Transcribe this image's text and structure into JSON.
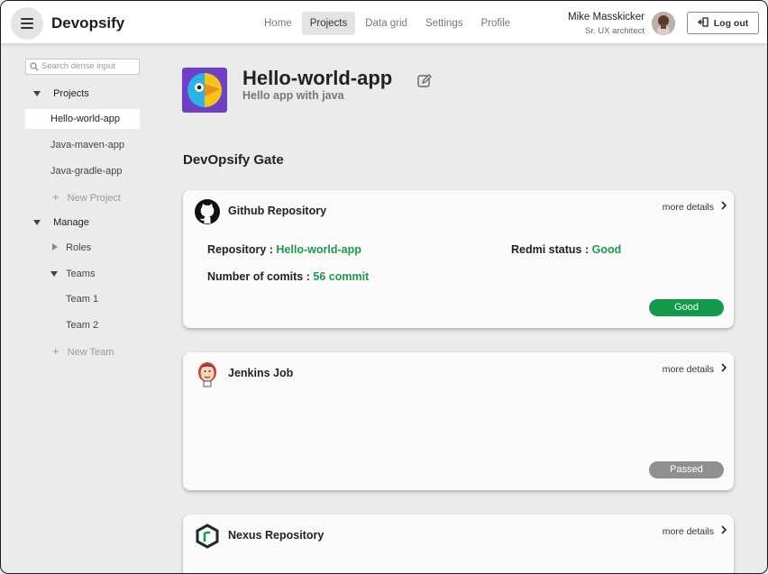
{
  "header": {
    "brand": "Devopsify",
    "nav": [
      {
        "label": "Home",
        "active": false
      },
      {
        "label": "Projects",
        "active": true
      },
      {
        "label": "Data grid",
        "active": false
      },
      {
        "label": "Settings",
        "active": false
      },
      {
        "label": "Profile",
        "active": false
      }
    ],
    "user": {
      "name": "Mike Masskicker",
      "role": "Sr. UX architect"
    },
    "logout_label": "Log out"
  },
  "sidebar": {
    "search_placeholder": "Search dense input",
    "projects_label": "Projects",
    "projects": [
      "Hello-world-app",
      "Java-maven-app",
      "Java-gradle-app"
    ],
    "new_project": "New Project",
    "manage_label": "Manage",
    "roles_label": "Roles",
    "teams_label": "Teams",
    "teams": [
      "Team 1",
      "Team 2"
    ],
    "new_team": "New Team"
  },
  "main": {
    "app_title": "Hello-world-app",
    "app_subtitle": "Hello app with java",
    "section_title": "DevOpsify Gate",
    "cards": [
      {
        "title": "Github Repository",
        "more": "more details",
        "repository_label": "Repository : ",
        "repository_value": "Hello-world-app",
        "redmi_label": "Redmi status : ",
        "redmi_value": "Good",
        "commits_label": "Number of comits : ",
        "commits_value": "56 commit",
        "status": "Good",
        "status_color": "#129a4b"
      },
      {
        "title": "Jenkins Job",
        "more": "more details",
        "status": "Passed",
        "status_color": "#8f8f8f"
      },
      {
        "title": "Nexus Repository",
        "more": "more details"
      }
    ]
  },
  "colors": {
    "accent_green": "#1e9a4a",
    "app_logo_bg": "#6f3fc6"
  }
}
